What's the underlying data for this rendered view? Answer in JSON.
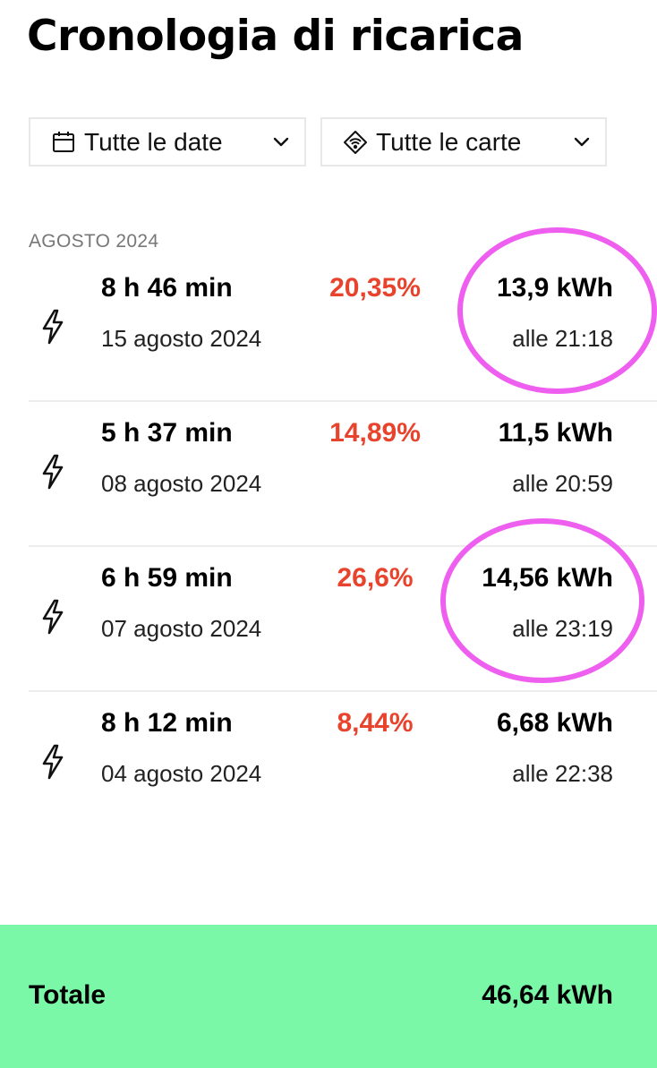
{
  "page": {
    "title": "Cronologia di ricarica"
  },
  "filters": {
    "dates": {
      "label": "Tutte le date",
      "icon": "calendar-icon"
    },
    "cards": {
      "label": "Tutte le carte",
      "icon": "rfid-card-icon"
    }
  },
  "section": {
    "label": "AGOSTO 2024"
  },
  "sessions": [
    {
      "duration": "8 h 46 min",
      "date": "15 agosto 2024",
      "percent": "20,35%",
      "energy": "13,9 kWh",
      "time": "alle 21:18",
      "highlighted": true
    },
    {
      "duration": "5 h 37 min",
      "date": "08 agosto 2024",
      "percent": "14,89%",
      "energy": "11,5 kWh",
      "time": "alle 20:59",
      "highlighted": false
    },
    {
      "duration": "6 h 59 min",
      "date": "07 agosto 2024",
      "percent": "26,6%",
      "energy": "14,56 kWh",
      "time": "alle 23:19",
      "highlighted": true
    },
    {
      "duration": "8 h 12 min",
      "date": "04 agosto 2024",
      "percent": "8,44%",
      "energy": "6,68 kWh",
      "time": "alle 22:38",
      "highlighted": false
    }
  ],
  "total": {
    "label": "Totale",
    "value": "46,64 kWh"
  },
  "colors": {
    "percent": "#e8432c",
    "total_bar": "#7bf8a7",
    "highlight": "#ee5ff0",
    "section_label": "#777777"
  }
}
